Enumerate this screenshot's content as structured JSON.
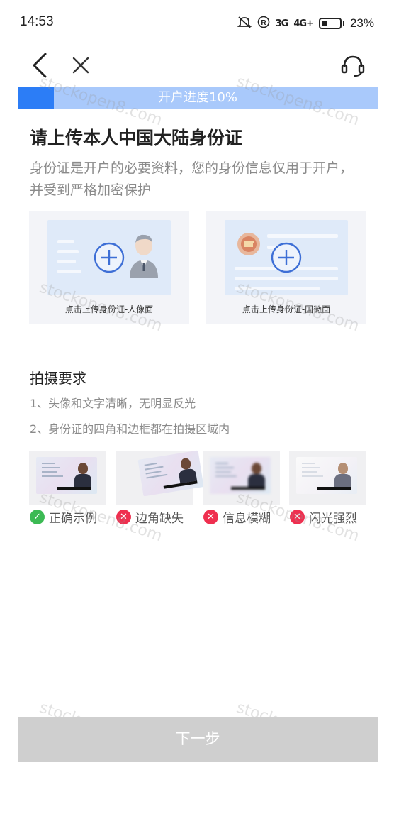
{
  "status_bar": {
    "time": "14:53",
    "signal_1": "3G",
    "signal_2": "4G+",
    "battery": "23%"
  },
  "nav": {
    "back_icon": "chevron-left-icon",
    "close_icon": "close-icon",
    "support_icon": "headset-icon"
  },
  "progress": {
    "label": "开户进度10%",
    "value": 0.1,
    "fill_color": "#2c7df6",
    "track_color": "#a9c9fb"
  },
  "main": {
    "title": "请上传本人中国大陆身份证",
    "subtitle": "身份证是开户的必要资料，您的身份信息仅用于开户，并受到严格加密保护"
  },
  "upload": {
    "front_caption": "点击上传身份证-人像面",
    "back_caption": "点击上传身份证-国徽面"
  },
  "requirements": {
    "title": "拍摄要求",
    "items": [
      "1、头像和文字清晰，无明显反光",
      "2、身份证的四角和边框都在拍摄区域内"
    ]
  },
  "examples": [
    {
      "label": "正确示例",
      "status": "ok"
    },
    {
      "label": "边角缺失",
      "status": "bad"
    },
    {
      "label": "信息模糊",
      "status": "bad"
    },
    {
      "label": "闪光强烈",
      "status": "bad"
    }
  ],
  "watermark": "stockopen8.com",
  "footer": {
    "next_label": "下一步"
  }
}
